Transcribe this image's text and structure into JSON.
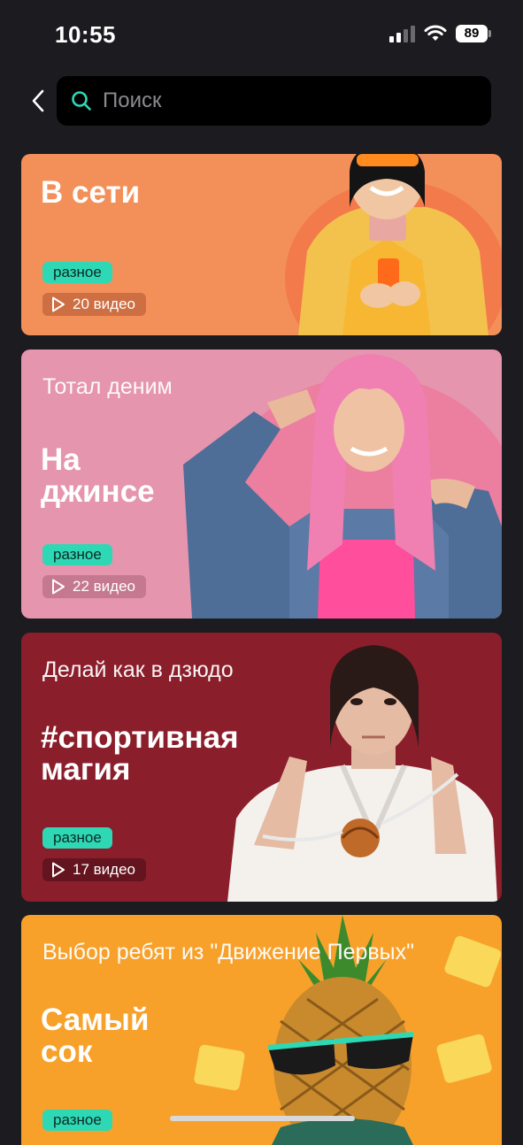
{
  "status": {
    "time": "10:55",
    "battery": "89",
    "icons": [
      "cellular-signal-icon",
      "wifi-icon",
      "battery-icon"
    ]
  },
  "header": {
    "back_icon": "chevron-left-icon",
    "search_icon": "search-icon",
    "search_placeholder": "Поиск",
    "accent": "#2ed8b5"
  },
  "cards": [
    {
      "subtitle": "",
      "title": "В сети",
      "tag": "разное",
      "count": "20 видео",
      "bg": "#f3905a"
    },
    {
      "subtitle": "Тотал деним",
      "title": "На\nджинсе",
      "tag": "разное",
      "count": "22 видео",
      "bg": "#e595ad"
    },
    {
      "subtitle": "Делай как в дзюдо",
      "title": "#спортивная\nмагия",
      "tag": "разное",
      "count": "17 видео",
      "bg": "#8b1e2b"
    },
    {
      "subtitle": "Выбор ребят из \"Движение Первых\"",
      "title": "Самый\nсок",
      "tag": "разное",
      "count": "",
      "bg": "#f7a12b"
    }
  ]
}
